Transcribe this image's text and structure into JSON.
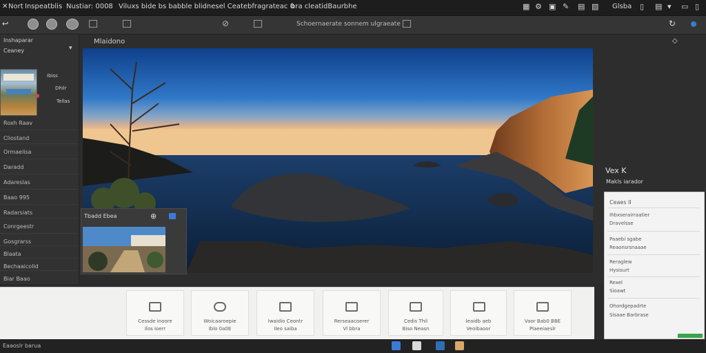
{
  "menubar": {
    "items": [
      "Nort",
      "Inspeatblis",
      "Nustiar: 0008",
      "Viluxs bide bs babble blidnesel Ceatebfragrateac 0",
      "bra cleatidBaurbhe"
    ],
    "right_icons": [
      "grid-icon",
      "settings-icon",
      "pen-icon",
      "image-icon",
      "user-icon",
      "window-icon",
      "document-icon"
    ],
    "right_label": "Glsba"
  },
  "toolbar": {
    "title": "Schoernaerate sonnem ulgraeate"
  },
  "sidebar": {
    "header": "Inshaparar",
    "subheader": "Ceaney",
    "thumb_labels": [
      "Ibiss",
      "Dhilr",
      "Tellas"
    ],
    "items": [
      "Roxh Raav",
      "Cliostand",
      "Ormaelisa",
      "Daradd",
      "Adareslas",
      "Baao 995",
      "Radarsiats",
      "Conrgeestr",
      "Gosgrarss",
      "Blaata",
      "Bechaaicolid",
      "Biar Baao"
    ]
  },
  "viewer": {
    "title": "Mlaidono",
    "right_title": "Vex K",
    "right_subtitle": "Makls iarador"
  },
  "thumb_panel": {
    "title": "Tbadd Ebea"
  },
  "properties": {
    "title": "Ceaes II",
    "rows": [
      [
        "Ihbxserairraatier",
        "Dravelsse"
      ],
      [
        "Paaebi sgabe",
        "Reaonsrsnaaae"
      ],
      [
        "Reraglew",
        "Hysisurt"
      ],
      [
        "Rexel",
        "Sioawt"
      ],
      [
        "Ohordgepadrte",
        "Sisaae Barbrase"
      ]
    ]
  },
  "tiles": [
    {
      "icon": "monitor-icon",
      "line1": "Cessde inoore",
      "line2": "Ilos ioerr"
    },
    {
      "icon": "cloud-icon",
      "line1": "Woicaaroepie",
      "line2": "Iblo 0a0E"
    },
    {
      "icon": "folder-icon",
      "line1": "Iwaidio Ceontr",
      "line2": "Ileo saiba"
    },
    {
      "icon": "image-icon",
      "line1": "Rerseaacoerer",
      "line2": "Vl bbra"
    },
    {
      "icon": "save-icon",
      "line1": "Cedis Thil",
      "line2": "Biso Neasn"
    },
    {
      "icon": "copy-icon",
      "line1": "Ieaidb aeb",
      "line2": "Veoibaoor"
    },
    {
      "icon": "layers-icon",
      "line1": "Vaor Bab0 BBE",
      "line2": "Plaeeiaeslr"
    }
  ],
  "status": {
    "left": "Eaaoslr barua"
  },
  "colors": {
    "accent_green": "#3aa44a",
    "accent_blue": "#3a7bd5"
  }
}
